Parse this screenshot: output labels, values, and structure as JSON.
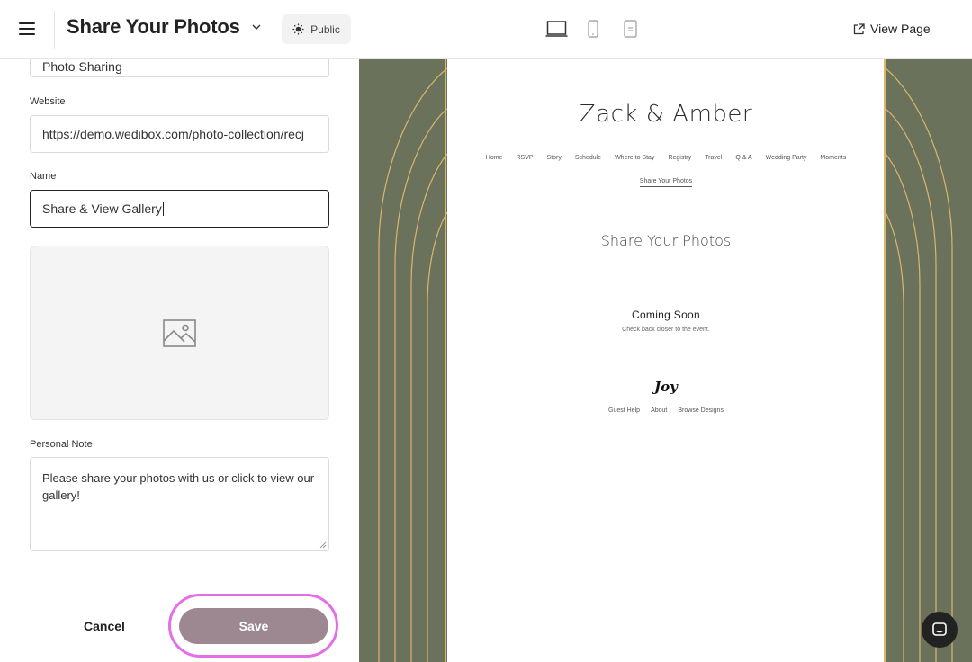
{
  "header": {
    "page_title": "Share Your Photos",
    "visibility": "Public",
    "view_page_label": "View Page"
  },
  "form": {
    "top_field_value": "Photo Sharing",
    "website_label": "Website",
    "website_value": "https://demo.wedibox.com/photo-collection/recj",
    "name_label": "Name",
    "name_value": "Share & View Gallery",
    "personal_note_label": "Personal Note",
    "personal_note_value": "Please share your photos with us or click to view our gallery!",
    "cancel_label": "Cancel",
    "save_label": "Save"
  },
  "preview": {
    "couple_name": "Zack & Amber",
    "nav": [
      "Home",
      "RSVP",
      "Story",
      "Schedule",
      "Where to Stay",
      "Registry",
      "Travel",
      "Q & A",
      "Wedding Party",
      "Moments"
    ],
    "nav_active": "Share Your Photos",
    "page_heading": "Share Your Photos",
    "coming_soon": "Coming Soon",
    "coming_soon_sub": "Check back closer to the event.",
    "logo": "Joy",
    "footer": [
      "Guest Help",
      "About",
      "Browse Designs"
    ]
  },
  "colors": {
    "accent_ring": "#e46ee6",
    "save_button": "#9d8790",
    "preview_bg": "#6b725c",
    "gold": "#d9b66c"
  },
  "icons": {
    "menu": "hamburger-icon",
    "dropdown": "chevron-down-icon",
    "visibility": "sun-icon",
    "desktop": "laptop-icon",
    "mobile": "phone-icon",
    "tablet": "tablet-icon",
    "external": "external-link-icon",
    "image": "image-placeholder-icon",
    "chat": "chat-icon"
  }
}
